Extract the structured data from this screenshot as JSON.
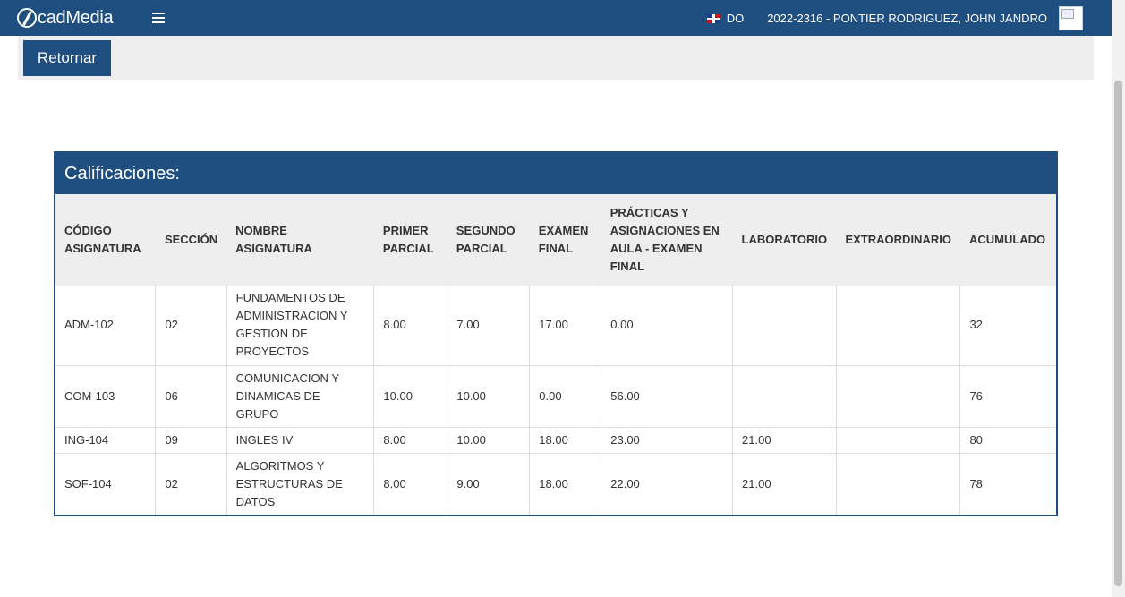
{
  "app": {
    "name": "cadMedia"
  },
  "header": {
    "lang_code": "DO",
    "user": "2022-2316 - PONTIER RODRIGUEZ, JOHN JANDRO"
  },
  "actions": {
    "back_label": "Retornar"
  },
  "panel": {
    "title": "Calificaciones:"
  },
  "table": {
    "columns": [
      "CÓDIGO ASIGNATURA",
      "SECCIÓN",
      "NOMBRE ASIGNATURA",
      "PRIMER PARCIAL",
      "SEGUNDO PARCIAL",
      "EXAMEN FINAL",
      "PRÁCTICAS Y ASIGNACIONES EN AULA - EXAMEN FINAL",
      "LABORATORIO",
      "EXTRAORDINARIO",
      "ACUMULADO"
    ],
    "rows": [
      [
        "ADM-102",
        "02",
        "FUNDAMENTOS DE ADMINISTRACION Y GESTION DE PROYECTOS",
        "8.00",
        "7.00",
        "17.00",
        "0.00",
        "",
        "",
        "32"
      ],
      [
        "COM-103",
        "06",
        "COMUNICACION Y DINAMICAS DE GRUPO",
        "10.00",
        "10.00",
        "0.00",
        "56.00",
        "",
        "",
        "76"
      ],
      [
        "ING-104",
        "09",
        "INGLES IV",
        "8.00",
        "10.00",
        "18.00",
        "23.00",
        "21.00",
        "",
        "80"
      ],
      [
        "SOF-104",
        "02",
        "ALGORITMOS Y ESTRUCTURAS DE DATOS",
        "8.00",
        "9.00",
        "18.00",
        "22.00",
        "21.00",
        "",
        "78"
      ]
    ]
  },
  "colors": {
    "primary": "#1f4e80",
    "bar_bg": "#eeeeee"
  },
  "icons": {
    "menu": "hamburger-icon",
    "flag": "dominican-flag-icon",
    "avatar": "broken-image-icon"
  }
}
